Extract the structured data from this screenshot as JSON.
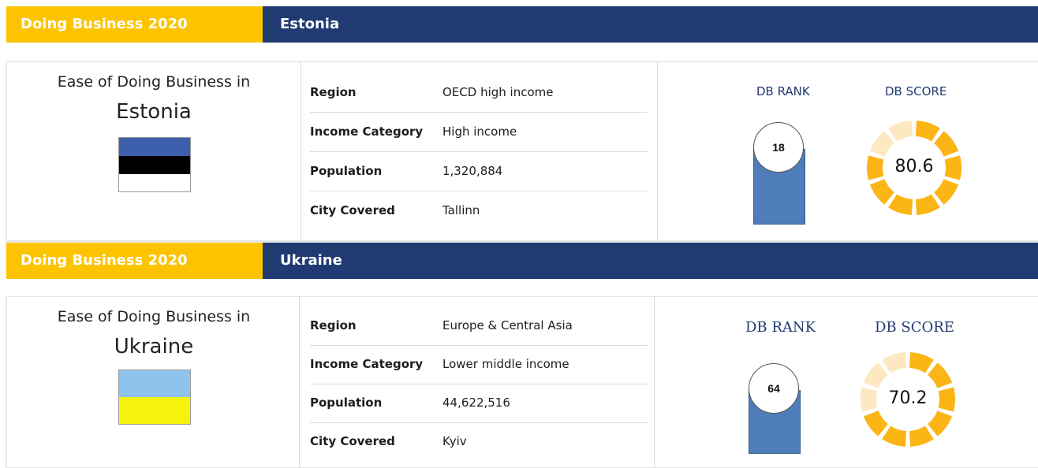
{
  "cards": [
    {
      "header_left": "Doing Business  2020",
      "header_country": "Estonia",
      "ease_label": "Ease of Doing Business in",
      "country": "Estonia",
      "flag_colors": [
        "#3d5fad",
        "#000000",
        "#ffffff"
      ],
      "info": [
        {
          "label": "Region",
          "value": "OECD high income"
        },
        {
          "label": "Income Category",
          "value": "High income"
        },
        {
          "label": "Population",
          "value": "1,320,884"
        },
        {
          "label": "City Covered",
          "value": "Tallinn"
        }
      ],
      "rank_title": "DB RANK",
      "rank": "18",
      "score_title": "DB SCORE",
      "score": "80.6",
      "score_value": 80.6
    },
    {
      "header_left": "Doing Business  2020",
      "header_country": "Ukraine",
      "ease_label": "Ease of Doing Business in",
      "country": "Ukraine",
      "flag_colors": [
        "#8ec3ee",
        "#f6f20c"
      ],
      "info": [
        {
          "label": "Region",
          "value": "Europe & Central Asia"
        },
        {
          "label": "Income Category",
          "value": "Lower middle income"
        },
        {
          "label": "Population",
          "value": "44,622,516"
        },
        {
          "label": "City Covered",
          "value": "Kyiv"
        }
      ],
      "rank_title": "DB RANK",
      "rank": "64",
      "score_title": "DB SCORE",
      "score": "70.2",
      "score_value": 70.2
    }
  ],
  "colors": {
    "accent_yellow": "#fcc400",
    "navy": "#203a72",
    "donut_filled": "#fbb515",
    "donut_empty": "#fde8c2",
    "rank_bar": "#4f7dba"
  }
}
